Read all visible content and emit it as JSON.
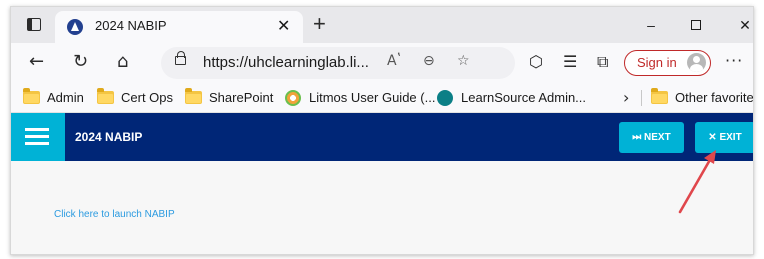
{
  "browser": {
    "tab": {
      "title": "2024 NABIP",
      "close": "✕"
    },
    "new_tab": "+",
    "window_controls": {
      "minimize": "–",
      "close": "✕"
    },
    "toolbar": {
      "back": "←",
      "refresh": "↻",
      "home": "⌂",
      "address": "https://uhclearninglab.li...",
      "read_aloud": "Aʽ",
      "zoom": "⊖",
      "favorite": "☆",
      "extensions": "⬡",
      "favorites_list": "☰",
      "collections": "⧉",
      "sign_in": "Sign in",
      "more": "···"
    },
    "favorites": [
      {
        "label": "Admin",
        "icon": "folder-icon"
      },
      {
        "label": "Cert Ops",
        "icon": "folder-icon"
      },
      {
        "label": "SharePoint",
        "icon": "folder-icon"
      },
      {
        "label": "Litmos User Guide (...",
        "icon": "litmos-icon"
      },
      {
        "label": "LearnSource Admin...",
        "icon": "sharepoint-icon"
      }
    ],
    "favorites_overflow": "›",
    "other_favorites": "Other favorites"
  },
  "app": {
    "title": "2024 NABIP",
    "next_label": "⏭ NEXT",
    "exit_label": "✕ EXIT",
    "launch_link": "Click here to launch NABIP"
  },
  "colors": {
    "header_bg": "#002677",
    "accent": "#00b2d6",
    "link": "#2c9be0",
    "annotation_arrow": "#e0474c"
  }
}
